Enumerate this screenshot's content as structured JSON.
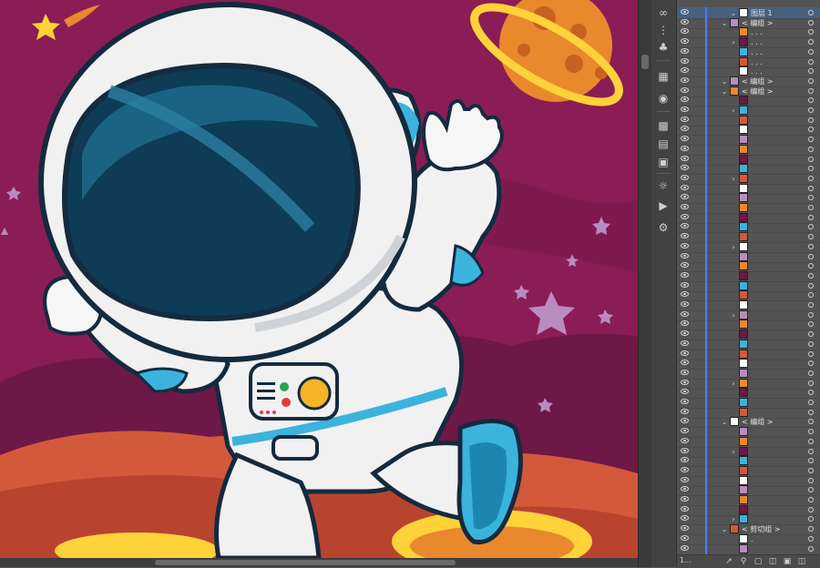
{
  "canvas": {
    "artwork_description": "astronaut waving",
    "colors": {
      "bg": "#8a1d55",
      "suit": "#f1f1f1",
      "visor": "#0e3b56",
      "accent_blue": "#3bb3dd",
      "planet": "#e9882d",
      "gold": "#ffd23a",
      "star": "#b98cc0"
    }
  },
  "toolstrip": {
    "tools": [
      "link-icon",
      "dots-icon",
      "brush-icon",
      "layers-icon",
      "align-icon",
      "pathfinder-icon",
      "transform-icon",
      "sun-icon",
      "play-icon",
      "gear-icon"
    ]
  },
  "layers": {
    "rows": [
      {
        "kind": "layer",
        "name": "图层 1",
        "selected": true
      },
      {
        "kind": "group",
        "name": "< 编组 >"
      },
      {
        "kind": "item",
        "name": ". . ."
      },
      {
        "kind": "item",
        "name": ". . ."
      },
      {
        "kind": "item",
        "name": ". . ."
      },
      {
        "kind": "item",
        "name": ". . ."
      },
      {
        "kind": "item",
        "name": ". . ."
      },
      {
        "kind": "group",
        "name": "< 编组 >"
      },
      {
        "kind": "group",
        "name": "< 编组 >"
      },
      {
        "kind": "item",
        "name": ""
      },
      {
        "kind": "item",
        "name": ""
      },
      {
        "kind": "item",
        "name": ""
      },
      {
        "kind": "item",
        "name": ""
      },
      {
        "kind": "item",
        "name": ""
      },
      {
        "kind": "item",
        "name": ""
      },
      {
        "kind": "item",
        "name": ""
      },
      {
        "kind": "item",
        "name": ""
      },
      {
        "kind": "item",
        "name": ""
      },
      {
        "kind": "item",
        "name": ""
      },
      {
        "kind": "item",
        "name": ""
      },
      {
        "kind": "item",
        "name": ""
      },
      {
        "kind": "item",
        "name": ""
      },
      {
        "kind": "item",
        "name": ""
      },
      {
        "kind": "item",
        "name": ""
      },
      {
        "kind": "item",
        "name": ""
      },
      {
        "kind": "item",
        "name": ""
      },
      {
        "kind": "item",
        "name": ""
      },
      {
        "kind": "item",
        "name": ""
      },
      {
        "kind": "item",
        "name": ""
      },
      {
        "kind": "item",
        "name": ""
      },
      {
        "kind": "item",
        "name": ""
      },
      {
        "kind": "item",
        "name": ""
      },
      {
        "kind": "item",
        "name": ""
      },
      {
        "kind": "item",
        "name": ""
      },
      {
        "kind": "item",
        "name": ""
      },
      {
        "kind": "item",
        "name": ""
      },
      {
        "kind": "item",
        "name": ""
      },
      {
        "kind": "item",
        "name": ""
      },
      {
        "kind": "item",
        "name": ""
      },
      {
        "kind": "item",
        "name": ""
      },
      {
        "kind": "item",
        "name": ""
      },
      {
        "kind": "item",
        "name": ""
      },
      {
        "kind": "group",
        "name": "< 编组 >"
      },
      {
        "kind": "item",
        "name": ""
      },
      {
        "kind": "item",
        "name": ""
      },
      {
        "kind": "item",
        "name": ""
      },
      {
        "kind": "item",
        "name": ""
      },
      {
        "kind": "item",
        "name": ""
      },
      {
        "kind": "item",
        "name": ""
      },
      {
        "kind": "item",
        "name": ""
      },
      {
        "kind": "item",
        "name": ""
      },
      {
        "kind": "item",
        "name": ""
      },
      {
        "kind": "item",
        "name": ""
      },
      {
        "kind": "group",
        "name": "< 剪切组 >"
      },
      {
        "kind": "item",
        "name": "."
      },
      {
        "kind": "item",
        "name": ""
      }
    ]
  },
  "footer": {
    "count": "1..."
  }
}
